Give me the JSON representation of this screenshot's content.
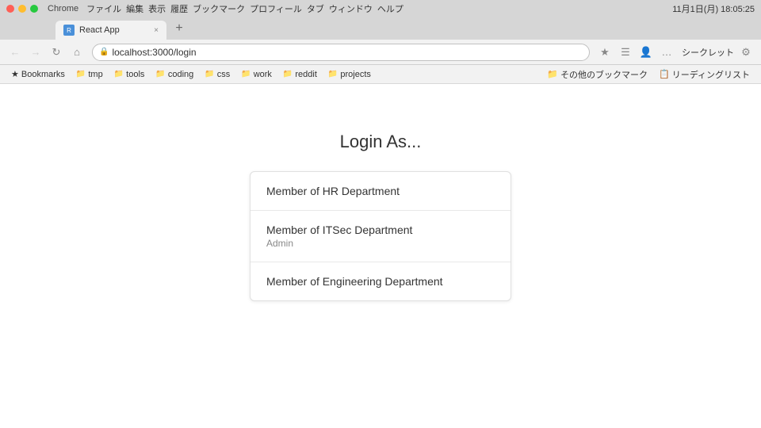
{
  "browser": {
    "app_name": "Chrome",
    "menu_items": [
      "ファイル",
      "編集",
      "表示",
      "履歴",
      "ブックマーク",
      "プロフィール",
      "タブ",
      "ウィンドウ",
      "ヘルプ"
    ],
    "datetime": "11月1日(月) 18:05:25",
    "tab_title": "React App",
    "tab_close": "×",
    "new_tab_label": "+",
    "address": "localhost:3000/login",
    "bookmarks": [
      {
        "label": "tmp",
        "icon": "📁"
      },
      {
        "label": "tools",
        "icon": "📁"
      },
      {
        "label": "coding",
        "icon": "📁"
      },
      {
        "label": "css",
        "icon": "📁"
      },
      {
        "label": "work",
        "icon": "📁"
      },
      {
        "label": "reddit",
        "icon": "📁"
      },
      {
        "label": "projects",
        "icon": "📁"
      }
    ],
    "bookmarks_right": [
      {
        "label": "その他のブックマーク"
      },
      {
        "label": "リーディングリスト"
      }
    ]
  },
  "page": {
    "title": "Login As...",
    "login_options": [
      {
        "title": "Member of HR Department",
        "subtitle": ""
      },
      {
        "title": "Member of ITSec Department",
        "subtitle": "Admin"
      },
      {
        "title": "Member of Engineering Department",
        "subtitle": ""
      }
    ]
  }
}
